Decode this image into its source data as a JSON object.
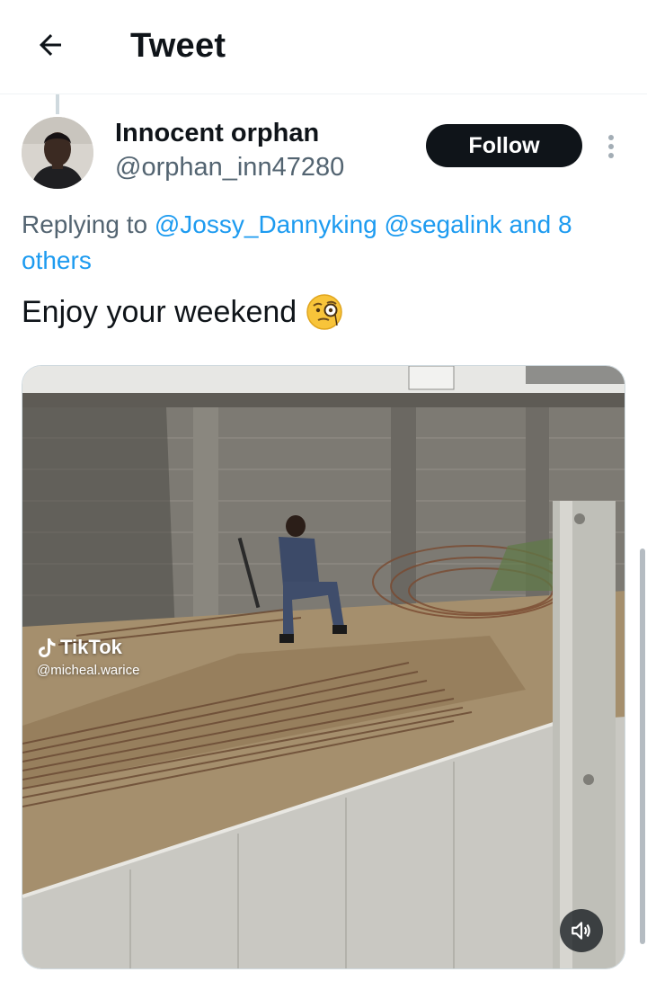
{
  "header": {
    "title": "Tweet",
    "back_icon": "arrow-left-icon"
  },
  "author": {
    "display_name": "Innocent orphan",
    "handle": "@orphan_inn47280",
    "avatar": "user-avatar"
  },
  "follow_button": {
    "label": "Follow"
  },
  "more_icon": "more-vertical-icon",
  "reply": {
    "prefix": "Replying to",
    "mention_1": "@Jossy_Dannyking",
    "mention_2": "@segalink",
    "others": "and 8 others"
  },
  "tweet": {
    "text": "Enjoy your weekend",
    "emoji": "monocle-face-emoji"
  },
  "media": {
    "watermark_brand": "TikTok",
    "watermark_user": "@micheal.warice",
    "mute_icon": "speaker-muted-icon"
  },
  "colors": {
    "link": "#1d9bf0",
    "secondary_text": "#536471",
    "primary_text": "#0f1419"
  }
}
